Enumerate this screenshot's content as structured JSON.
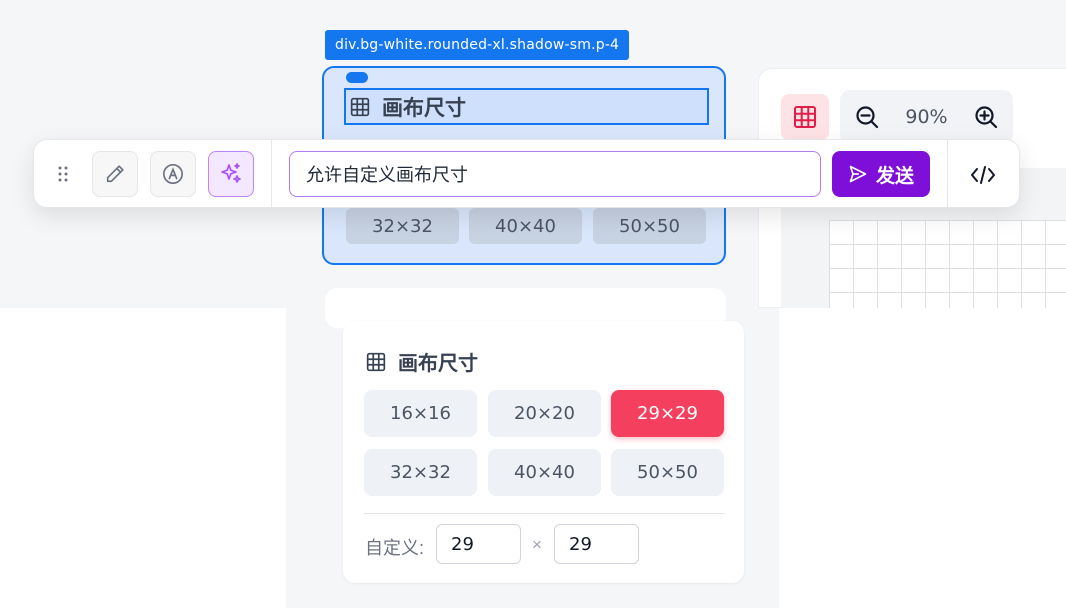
{
  "colors": {
    "selection_blue": "#1577f0",
    "brand_purple": "#7e0fd9",
    "accent_rose": "#f43f5e"
  },
  "selection": {
    "tag": "div.bg-white.rounded-xl.shadow-sm.p-4",
    "heading": "画布尺寸",
    "ghost_sizes": [
      "32×32",
      "40×40",
      "50×50"
    ]
  },
  "right_panel": {
    "zoom_level": "90%",
    "icons": [
      "grid-icon",
      "zoom-out-icon",
      "zoom-in-icon"
    ]
  },
  "toolbar": {
    "tools": [
      "drag-handle-icon",
      "pencil-icon",
      "text-style-icon",
      "sparkles-icon"
    ],
    "prompt_value": "允许自定义画布尺寸",
    "send_label": "发送",
    "code_icon": "code-icon"
  },
  "size_card": {
    "title": "画布尺寸",
    "sizes": [
      "16×16",
      "20×20",
      "29×29",
      "32×32",
      "40×40",
      "50×50"
    ],
    "selected_size": "29×29",
    "custom_label": "自定义:",
    "custom_width": "29",
    "times": "×",
    "custom_height": "29"
  }
}
